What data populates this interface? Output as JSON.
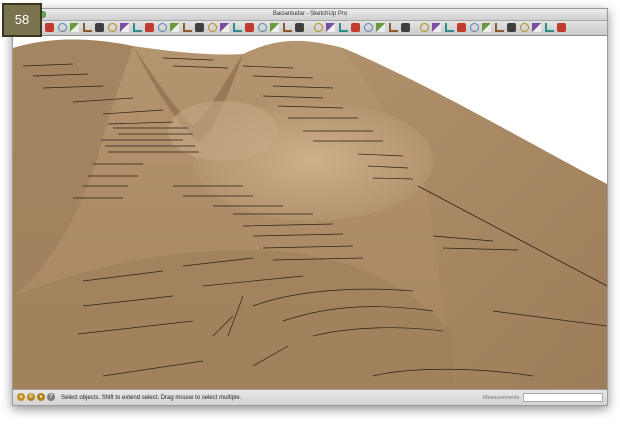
{
  "badge": {
    "number": "58"
  },
  "window": {
    "title": "Baciantudar - SketchUp Pro"
  },
  "toolbar": {
    "tools": [
      "pencil-icon",
      "eraser-icon",
      "rectangle-icon",
      "circle-icon",
      "arc-icon",
      "polygon-icon",
      "paint-bucket-icon",
      "move-icon",
      "rotate-icon",
      "push-pull-icon",
      "follow-me-icon",
      "scale-icon",
      "offset-icon",
      "tape-measure-icon",
      "protractor-icon",
      "text-icon",
      "axes-icon",
      "3d-text-icon",
      "section-plane-icon",
      "orbit-icon",
      "pan-icon",
      "zoom-icon",
      "zoom-extents-icon",
      "iso-view-icon",
      "top-view-icon",
      "front-view-icon",
      "right-view-icon",
      "back-view-icon",
      "left-view-icon",
      "xray-icon",
      "wireframe-icon",
      "hidden-line-icon",
      "shaded-icon",
      "textured-icon",
      "monochrome-icon",
      "components-icon",
      "materials-icon",
      "styles-icon",
      "layers-icon",
      "shadows-icon",
      "get-models-icon"
    ]
  },
  "status": {
    "message": "Select objects. Shift to extend select. Drag mouse to select multiple.",
    "measurements_label": "Measurements",
    "measurements_value": ""
  },
  "colors": {
    "terrain_light": "#c9a983",
    "terrain_mid": "#a98a66",
    "terrain_dark": "#7e6548",
    "contour": "#2b2218",
    "badge": "#7a7350"
  }
}
